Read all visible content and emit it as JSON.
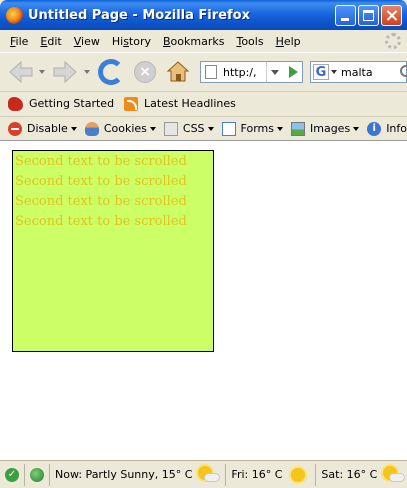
{
  "window": {
    "title": "Untitled Page - Mozilla Firefox"
  },
  "menu": {
    "items": [
      {
        "label": "File",
        "key": "F"
      },
      {
        "label": "Edit",
        "key": "E"
      },
      {
        "label": "View",
        "key": "V"
      },
      {
        "label": "History",
        "key": "s"
      },
      {
        "label": "Bookmarks",
        "key": "B"
      },
      {
        "label": "Tools",
        "key": "T"
      },
      {
        "label": "Help",
        "key": "H"
      }
    ]
  },
  "navigation": {
    "url": "http:/,",
    "search_value": "malta",
    "search_engine_icon": "G"
  },
  "bookmarks": {
    "items": [
      {
        "label": "Getting Started",
        "icon": "firefox-bookmark-icon"
      },
      {
        "label": "Latest Headlines",
        "icon": "rss-feed-icon"
      }
    ]
  },
  "devtoolbar": {
    "items": [
      {
        "label": "Disable",
        "icon": "disable-icon"
      },
      {
        "label": "Cookies",
        "icon": "cookies-icon"
      },
      {
        "label": "CSS",
        "icon": "css-icon"
      },
      {
        "label": "Forms",
        "icon": "forms-icon"
      },
      {
        "label": "Images",
        "icon": "images-icon"
      },
      {
        "label": "Information",
        "icon": "information-icon"
      }
    ]
  },
  "content": {
    "scroll_box": {
      "background": "#ccff66",
      "text_color": "#e5c21c",
      "lines": [
        "Second text to be scrolled",
        "Second text to be scrolled",
        "Second text to be scrolled",
        "Second text to be scrolled"
      ]
    }
  },
  "status": {
    "now": "Now: Partly Sunny, 15° C",
    "fri": "Fri: 16° C",
    "sat": "Sat: 16° C"
  }
}
